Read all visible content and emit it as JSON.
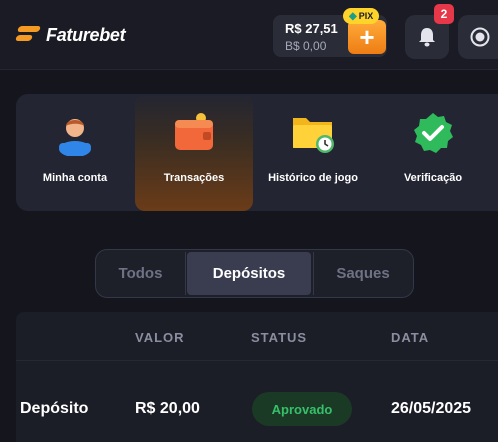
{
  "header": {
    "brand": "Faturebet",
    "balance": "R$ 27,51",
    "bonus_balance": "B$ 0,00",
    "deposit_symbol": "+",
    "pix_label": "PIX",
    "notifications_count": "2"
  },
  "menu": {
    "items": [
      {
        "label": "Minha conta",
        "icon": "user-icon"
      },
      {
        "label": "Transações",
        "icon": "wallet-icon",
        "active": true
      },
      {
        "label": "Histórico de jogo",
        "icon": "folder-clock-icon"
      },
      {
        "label": "Verificação",
        "icon": "check-shield-icon"
      }
    ]
  },
  "tabs": {
    "items": [
      "Todos",
      "Depósitos",
      "Saques"
    ],
    "active": "Depósitos"
  },
  "table": {
    "headers": [
      "VALOR",
      "STATUS",
      "DATA"
    ],
    "rows": [
      {
        "type": "Depósito",
        "value": "R$ 20,00",
        "status": "Aprovado",
        "date": "26/05/2025"
      }
    ]
  },
  "colors": {
    "accent": "#f59a23",
    "status_approved": "#36c06a",
    "badge": "#e7384a"
  }
}
